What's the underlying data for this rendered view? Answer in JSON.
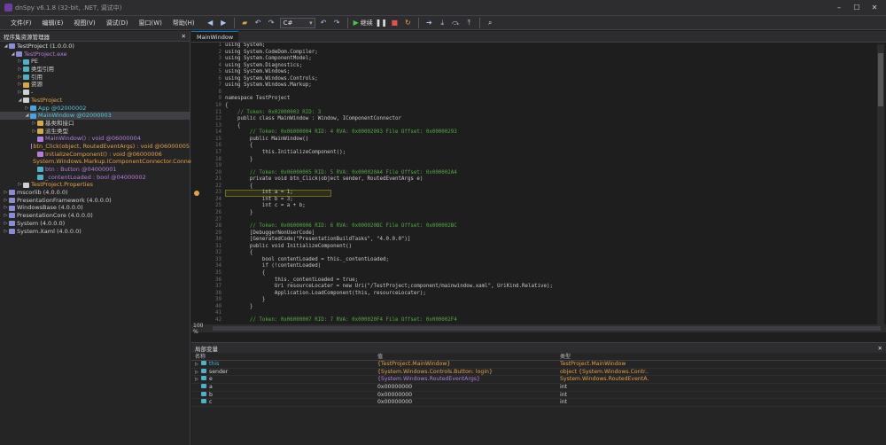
{
  "window": {
    "title": "dnSpy v6.1.8 (32-bit, .NET, 调试中)"
  },
  "menu": [
    "文件(F)",
    "编辑(E)",
    "视图(V)",
    "调试(D)",
    "窗口(W)",
    "帮助(H)"
  ],
  "toolbar": {
    "language": "C#",
    "continue_label": "继续"
  },
  "explorer": {
    "title": "程序集资源管理器",
    "nodes": [
      {
        "depth": 0,
        "exp": "◢",
        "icon": "asm",
        "text": "TestProject (1.0.0.0)",
        "cls": "c-asm"
      },
      {
        "depth": 1,
        "exp": "◢",
        "icon": "asm",
        "text": "TestProject.exe",
        "cls": "purple"
      },
      {
        "depth": 2,
        "exp": "▷",
        "icon": "fld",
        "text": "PE",
        "cls": ""
      },
      {
        "depth": 2,
        "exp": "▷",
        "icon": "fld",
        "text": "类型引用",
        "cls": ""
      },
      {
        "depth": 2,
        "exp": "▷",
        "icon": "fld",
        "text": "引用",
        "cls": ""
      },
      {
        "depth": 2,
        "exp": "▷",
        "icon": "fold",
        "text": "资源",
        "cls": ""
      },
      {
        "depth": 2,
        "exp": "▷",
        "icon": "ns",
        "text": "-",
        "cls": ""
      },
      {
        "depth": 2,
        "exp": "◢",
        "icon": "ns",
        "text": "TestProject",
        "cls": "orange"
      },
      {
        "depth": 3,
        "exp": "▷",
        "icon": "cls",
        "text": "App @02000002",
        "cls": "teal"
      },
      {
        "depth": 3,
        "exp": "◢",
        "icon": "cls",
        "text": "MainWindow @02000003",
        "cls": "teal",
        "sel": true
      },
      {
        "depth": 4,
        "exp": "▷",
        "icon": "fold",
        "text": "基类和接口",
        "cls": ""
      },
      {
        "depth": 4,
        "exp": "▷",
        "icon": "fold",
        "text": "派生类型",
        "cls": ""
      },
      {
        "depth": 4,
        "exp": "",
        "icon": "meth",
        "text": "MainWindow() : void @06000004",
        "cls": "purple"
      },
      {
        "depth": 4,
        "exp": "",
        "icon": "meth",
        "text": "btn_Click(object, RoutedEventArgs) : void @06000005",
        "cls": "orange"
      },
      {
        "depth": 4,
        "exp": "",
        "icon": "meth",
        "text": "InitializeComponent() : void @06000006",
        "cls": "orange"
      },
      {
        "depth": 4,
        "exp": "",
        "icon": "meth",
        "text": "System.Windows.Markup.IComponentConnector.Connect(int, object) : void",
        "cls": "orange"
      },
      {
        "depth": 4,
        "exp": "",
        "icon": "fld",
        "text": "btn : Button @04000001",
        "cls": "purple"
      },
      {
        "depth": 4,
        "exp": "",
        "icon": "fld",
        "text": "_contentLoaded : bool @04000002",
        "cls": "purple"
      },
      {
        "depth": 2,
        "exp": "▷",
        "icon": "ns",
        "text": "TestProject.Properties",
        "cls": "orange"
      },
      {
        "depth": 0,
        "exp": "▷",
        "icon": "asm",
        "text": "mscorlib (4.0.0.0)",
        "cls": ""
      },
      {
        "depth": 0,
        "exp": "▷",
        "icon": "asm",
        "text": "PresentationFramework (4.0.0.0)",
        "cls": ""
      },
      {
        "depth": 0,
        "exp": "▷",
        "icon": "asm",
        "text": "WindowsBase (4.0.0.0)",
        "cls": ""
      },
      {
        "depth": 0,
        "exp": "▷",
        "icon": "asm",
        "text": "PresentationCore (4.0.0.0)",
        "cls": ""
      },
      {
        "depth": 0,
        "exp": "▷",
        "icon": "asm",
        "text": "System (4.0.0.0)",
        "cls": ""
      },
      {
        "depth": 0,
        "exp": "▷",
        "icon": "asm",
        "text": "System.Xaml (4.0.0.0)",
        "cls": ""
      }
    ]
  },
  "editor": {
    "tab": "MainWindow",
    "zoom": "100 %",
    "lines": [
      "using System;",
      "using System.CodeDom.Compiler;",
      "using System.ComponentModel;",
      "using System.Diagnostics;",
      "using System.Windows;",
      "using System.Windows.Controls;",
      "using System.Windows.Markup;",
      "",
      "namespace TestProject",
      "{",
      "    // Token: 0x02000003 RID: 3",
      "    public class MainWindow : Window, IComponentConnector",
      "    {",
      "        // Token: 0x06000004 RID: 4 RVA: 0x00002093 File Offset: 0x00000293",
      "        public MainWindow()",
      "        {",
      "            this.InitializeComponent();",
      "        }",
      "",
      "        // Token: 0x06000005 RID: 5 RVA: 0x000020A4 File Offset: 0x000002A4",
      "        private void btn_Click(object sender, RoutedEventArgs e)",
      "        {",
      "            int a = 1;",
      "            int b = 3;",
      "            int c = a + b;",
      "        }",
      "",
      "        // Token: 0x06000006 RID: 6 RVA: 0x000020BC File Offset: 0x000002BC",
      "        [DebuggerNonUserCode]",
      "        [GeneratedCode(\"PresentationBuildTasks\", \"4.0.0.0\")]",
      "        public void InitializeComponent()",
      "        {",
      "            bool contentLoaded = this._contentLoaded;",
      "            if (!contentLoaded)",
      "            {",
      "                this._contentLoaded = true;",
      "                Uri resourceLocater = new Uri(\"/TestProject;component/mainwindow.xaml\", UriKind.Relative);",
      "                Application.LoadComponent(this, resourceLocater);",
      "            }",
      "        }",
      "",
      "        // Token: 0x06000007 RID: 7 RVA: 0x000020F4 File Offset: 0x000002F4"
    ]
  },
  "locals": {
    "title": "局部变量",
    "headers": [
      "名称",
      "值",
      "类型"
    ],
    "rows": [
      {
        "name": "this",
        "value": "{TestProject.MainWindow}",
        "type": "TestProject.MainWindow",
        "exp": "▷"
      },
      {
        "name": "sender",
        "value": "{System.Windows.Controls.Button: login}",
        "type": "object {System.Windows.Contr...",
        "exp": "▷"
      },
      {
        "name": "e",
        "value": "{System.Windows.RoutedEventArgs}",
        "type": "System.Windows.RoutedEventA...",
        "exp": "▷"
      },
      {
        "name": "a",
        "value": "0x00000000",
        "type": "int",
        "exp": ""
      },
      {
        "name": "b",
        "value": "0x00000000",
        "type": "int",
        "exp": ""
      },
      {
        "name": "c",
        "value": "0x00000000",
        "type": "int",
        "exp": ""
      }
    ]
  }
}
